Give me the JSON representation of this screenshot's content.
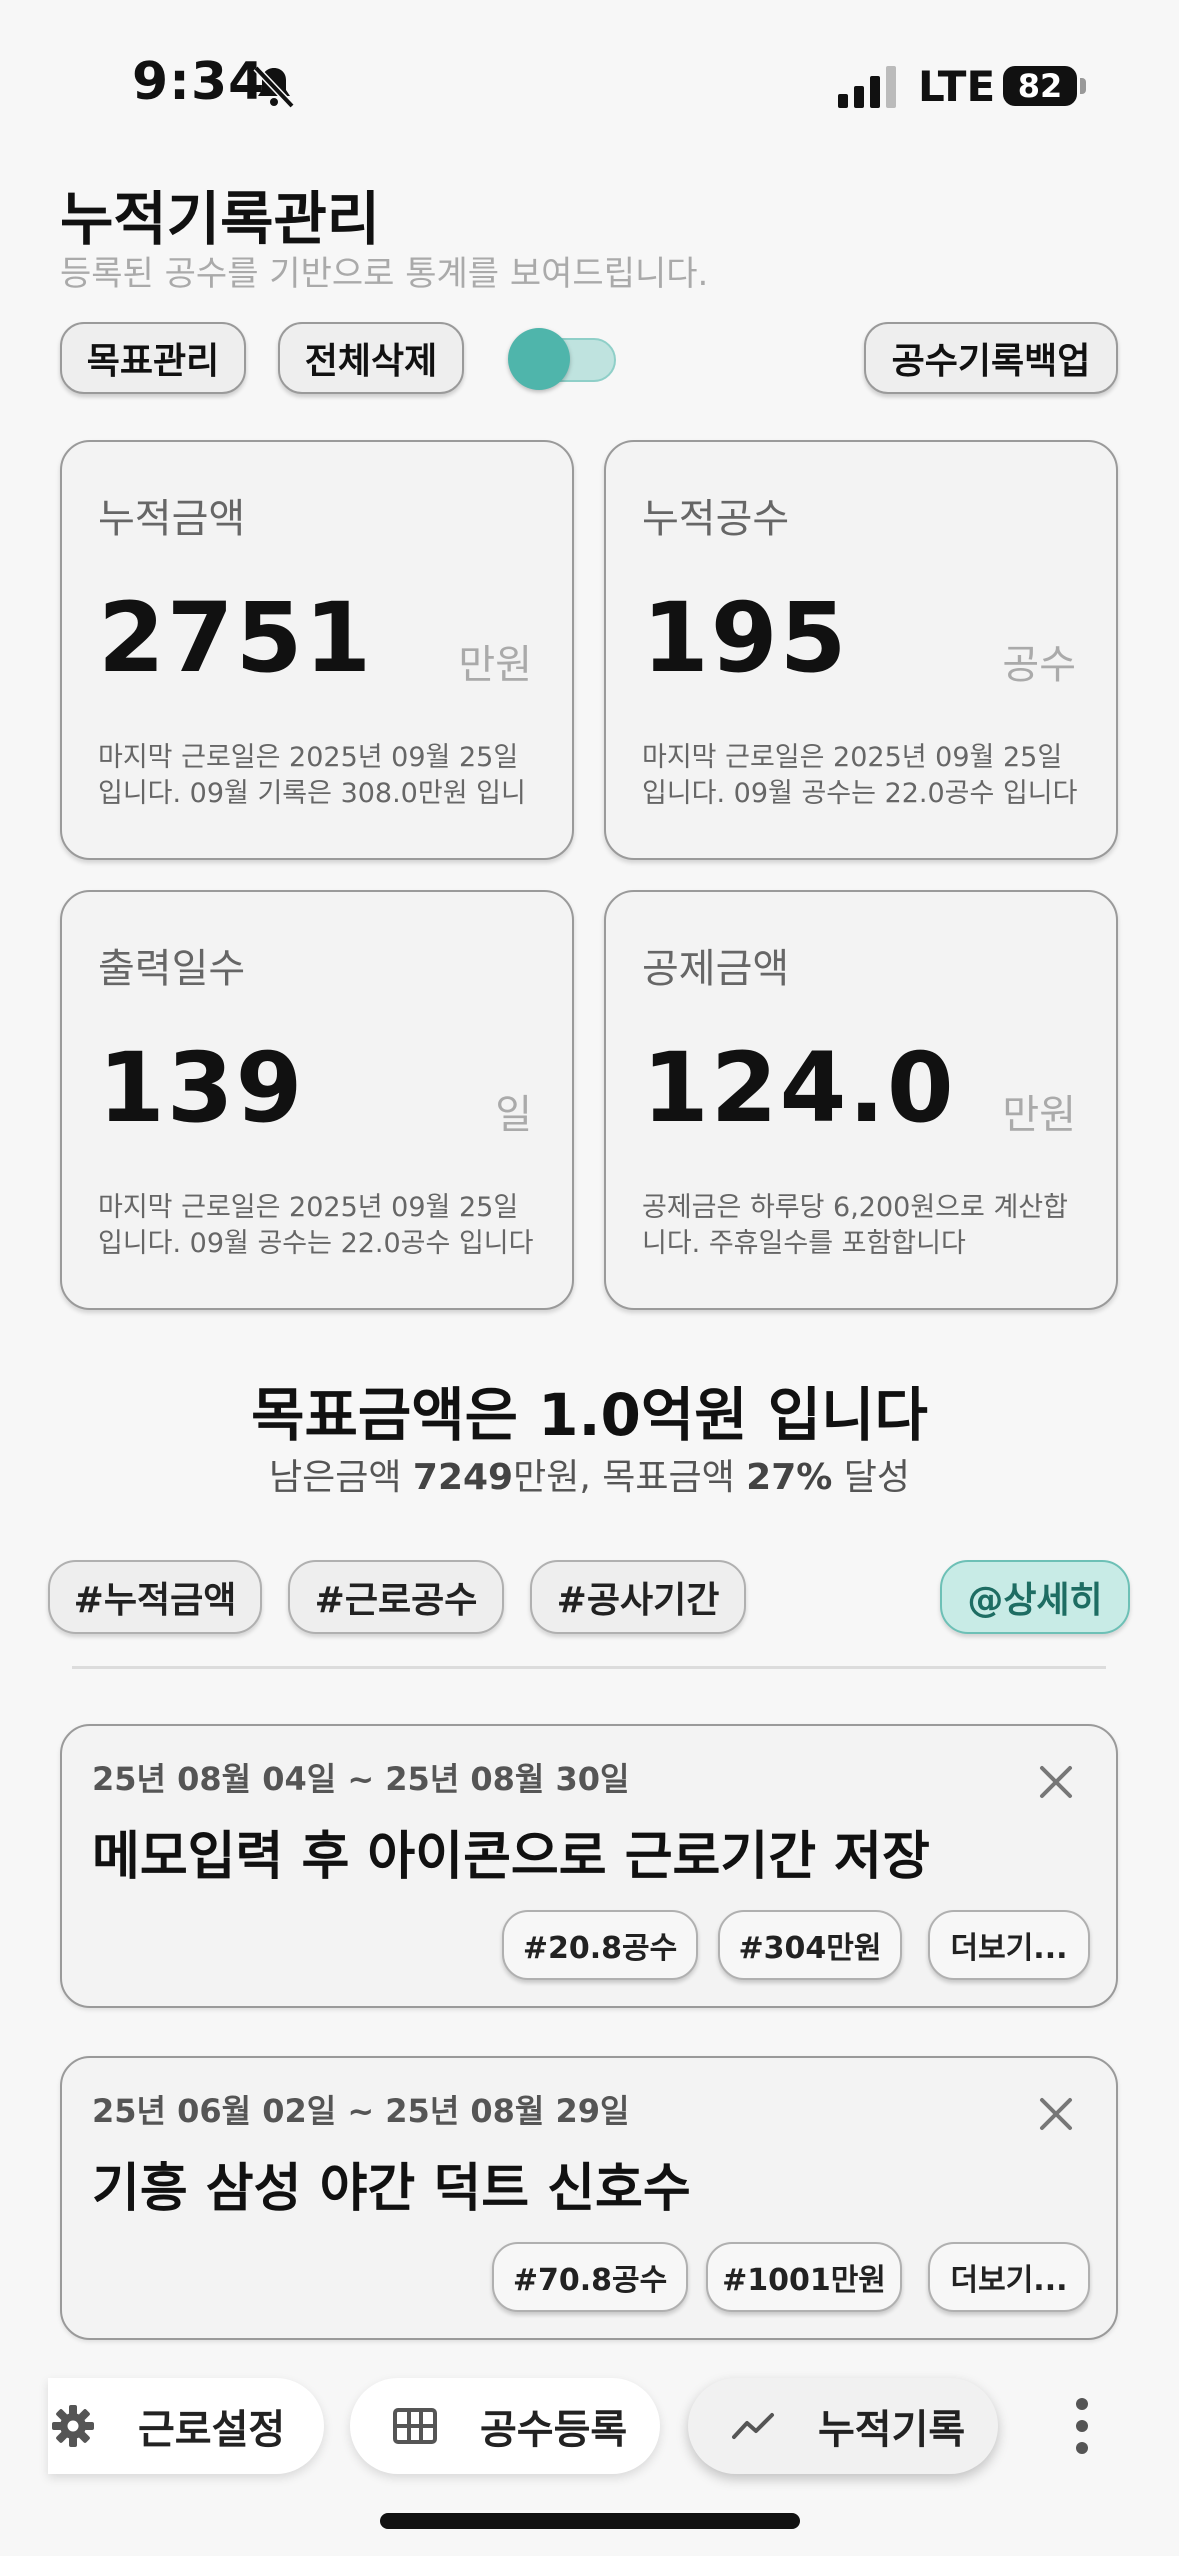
{
  "status_bar": {
    "time": "9:34",
    "network": "LTE",
    "battery": "82"
  },
  "header": {
    "title": "누적기록관리",
    "subtitle": "등록된 공수를 기반으로 통계를 보여드립니다."
  },
  "toolbar": {
    "goal_button": "목표관리",
    "delete_all_button": "전체삭제",
    "toggle_on": true,
    "backup_button": "공수기록백업"
  },
  "stats": [
    {
      "label": "누적금액",
      "value": "2751",
      "unit": "만원",
      "note": "마지막 근로일은 2025년 09월 25일 입니다. 09월 기록은 308.0만원 입니"
    },
    {
      "label": "누적공수",
      "value": "195",
      "unit": "공수",
      "note": "마지막 근로일은 2025년 09월 25일 입니다. 09월 공수는 22.0공수 입니다"
    },
    {
      "label": "출력일수",
      "value": "139",
      "unit": "일",
      "note": "마지막 근로일은 2025년 09월 25일 입니다. 09월 공수는 22.0공수 입니다"
    },
    {
      "label": "공제금액",
      "value": "124.0",
      "unit": "만원",
      "note": "공제금은 하루당 6,200원으로 계산합니다. 주휴일수를 포함합니다"
    }
  ],
  "goal": {
    "title_prefix": "목표금액은 ",
    "title_value": "1.0",
    "title_suffix": "억원 입니다",
    "remaining_prefix": "남은금액 ",
    "remaining_value": "7249",
    "remaining_suffix": "만원, 목표금액 ",
    "percent": "27%",
    "percent_suffix": " 달성"
  },
  "tags": {
    "amount": "#누적금액",
    "labor": "#근로공수",
    "period": "#공사기간",
    "detail": "@상세히"
  },
  "records": [
    {
      "date": "25년 08월 04일 ~ 25년 08월 30일",
      "title": "메모입력 후 아이콘으로 근로기간 저장",
      "chip_labor": "#20.8공수",
      "chip_amount": "#304만원",
      "more": "더보기..."
    },
    {
      "date": "25년 06월 02일 ~ 25년 08월 29일",
      "title": "기흥 삼성 야간 덕트 신호수",
      "chip_labor": "#70.8공수",
      "chip_amount": "#1001만원",
      "more": "더보기..."
    }
  ],
  "nav": {
    "settings": "근로설정",
    "register": "공수등록",
    "records": "누적기록"
  },
  "colors": {
    "accent": "#4fb5ab",
    "accent_light": "#c8ebe6"
  }
}
